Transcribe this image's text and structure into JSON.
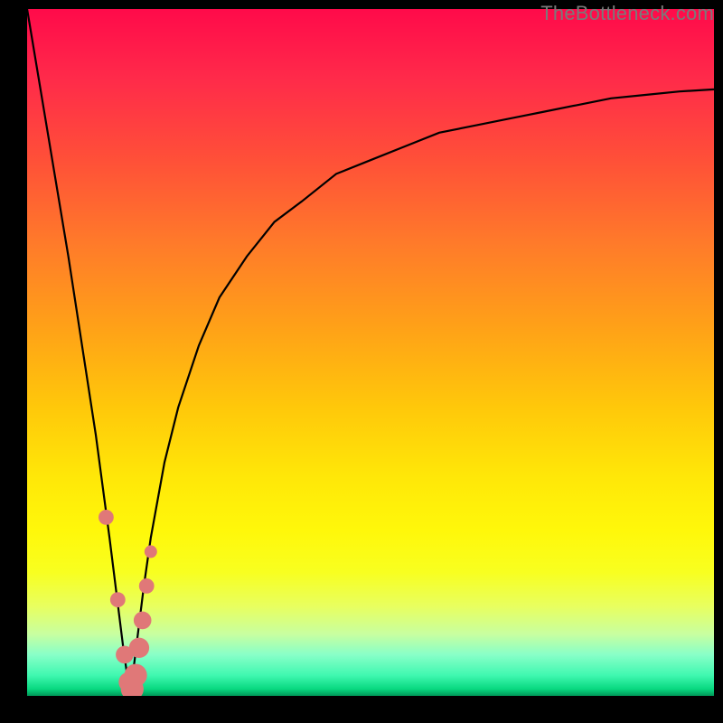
{
  "watermark": "TheBottleneck.com",
  "colors": {
    "curve_stroke": "#000000",
    "marker_fill": "#e07878",
    "marker_stroke": "#c05858",
    "frame_bg": "#000000"
  },
  "chart_data": {
    "type": "line",
    "title": "",
    "xlabel": "",
    "ylabel": "",
    "xlim": [
      0,
      100
    ],
    "ylim": [
      0,
      100
    ],
    "grid": false,
    "legend": false,
    "annotations": [],
    "note": "Bottleneck percentage curve. V-shaped: falls near-linearly to a null point around x≈15 then rises with diminishing slope toward an asymptote near y≈90. Values estimated from pixel positions (no axis ticks/labels are rendered).",
    "series": [
      {
        "name": "bottleneck-curve",
        "x": [
          0,
          2,
          4,
          6,
          8,
          10,
          12,
          13,
          14,
          15,
          16,
          17,
          18,
          20,
          22,
          25,
          28,
          32,
          36,
          40,
          45,
          50,
          55,
          60,
          65,
          70,
          75,
          80,
          85,
          90,
          95,
          100
        ],
        "y": [
          100,
          88,
          76,
          64,
          51,
          38,
          23,
          15,
          7,
          0,
          8,
          16,
          23,
          34,
          42,
          51,
          58,
          64,
          69,
          72,
          76,
          78,
          80,
          82,
          83,
          84,
          85,
          86,
          87,
          87.5,
          88,
          88.3
        ]
      }
    ],
    "markers": {
      "name": "highlighted-points",
      "note": "Pink dots clustered around the minimum of the V.",
      "x": [
        11.5,
        13.2,
        14.2,
        14.8,
        15.3,
        15.8,
        16.3,
        16.8,
        17.4,
        18.0
      ],
      "y": [
        26,
        14,
        6,
        2,
        1,
        3,
        7,
        11,
        16,
        21
      ],
      "r": [
        1.2,
        1.2,
        1.4,
        1.6,
        1.8,
        1.8,
        1.6,
        1.4,
        1.2,
        1.0
      ]
    }
  }
}
